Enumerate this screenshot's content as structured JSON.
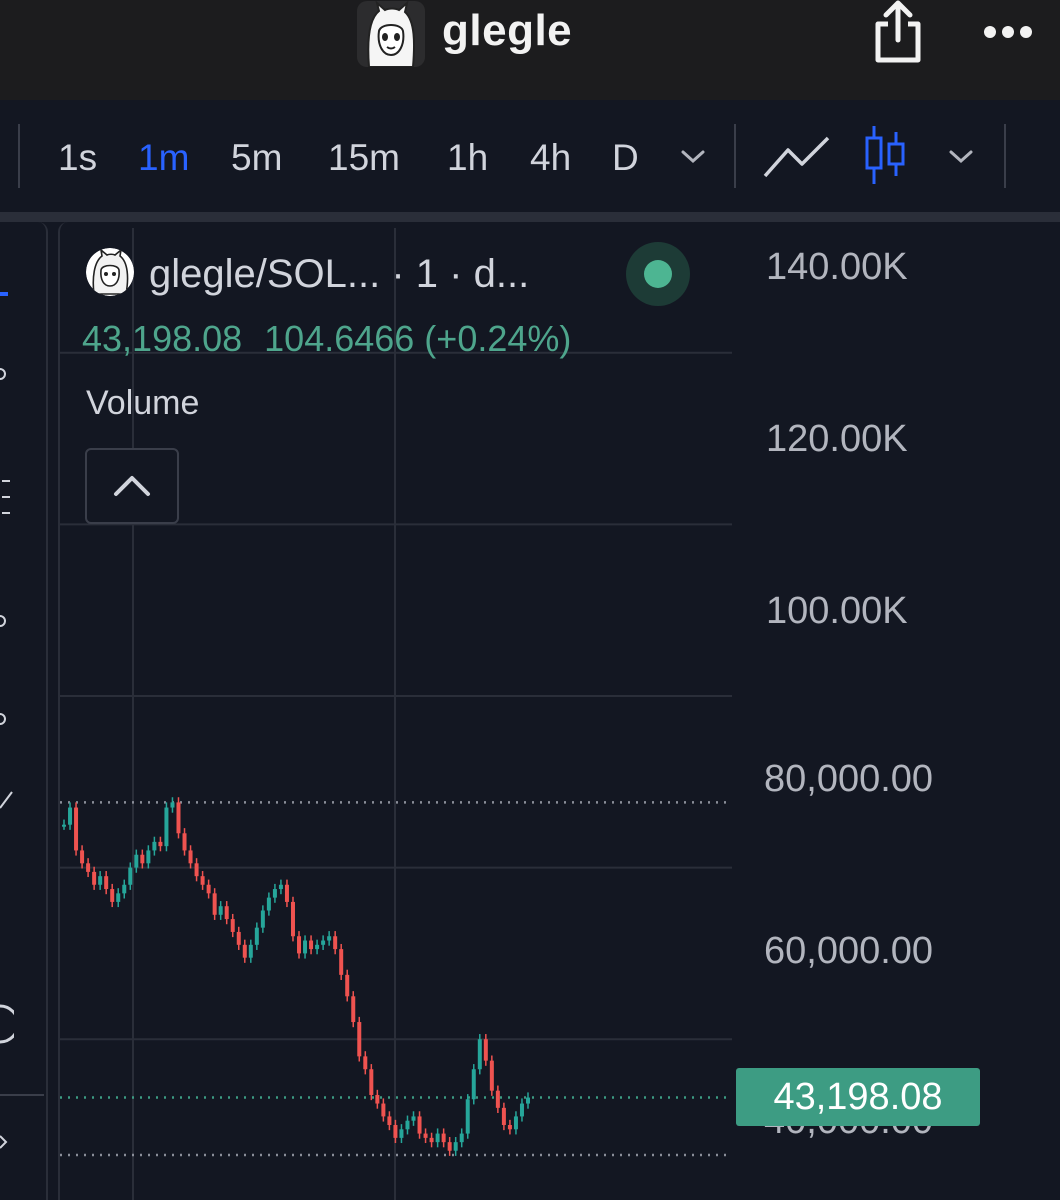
{
  "app": {
    "title": "glegle"
  },
  "toolbar": {
    "timeframes": [
      "1s",
      "1m",
      "5m",
      "15m",
      "1h",
      "4h",
      "D"
    ],
    "active_timeframe": "1m"
  },
  "legend": {
    "symbol": "glegle/SOL... · 1 · d...",
    "last_price": "43,198.08",
    "change": "104.6466 (+0.24%)",
    "volume_label": "Volume",
    "status": "live"
  },
  "price_axis": {
    "labels": [
      "140.00K",
      "120.00K",
      "100.00K",
      "80,000.00",
      "60,000.00",
      "40,000.00"
    ],
    "current_price_tag": "43,198.08"
  },
  "colors": {
    "background": "#131722",
    "accent": "#2962ff",
    "up": "#26a69a",
    "down": "#ef5350",
    "price_tag": "#3d9c83"
  },
  "chart_data": {
    "type": "line",
    "title": "",
    "xlabel": "",
    "ylabel": "",
    "ylim": [
      36000,
      145000
    ],
    "grid": true,
    "reference_lines": [
      77600,
      43198.08,
      36500
    ],
    "series": [
      {
        "values": [
          75000,
          77000,
          72000,
          70500,
          69500,
          68000,
          69000,
          67500,
          66000,
          67000,
          68000,
          70000,
          71500,
          70500,
          72000,
          73000,
          72500,
          77000,
          77600,
          74000,
          72000,
          70500,
          69000,
          68000,
          67000,
          64500,
          65500,
          64000,
          62500,
          61000,
          59500,
          61000,
          63000,
          65000,
          66500,
          67500,
          68000,
          66000,
          62000,
          60000,
          61500,
          60500,
          61000,
          61500,
          62000,
          60500,
          57500,
          55000,
          52000,
          48000,
          46500,
          43500,
          42500,
          41000,
          40000,
          38500,
          39500,
          40500,
          41000,
          39000,
          38500,
          38000,
          39000,
          38000,
          37000,
          38000,
          39000,
          43000,
          46500,
          50000,
          47500,
          44000,
          42000,
          40000,
          39500,
          41000,
          42500,
          43198.08
        ]
      }
    ]
  }
}
